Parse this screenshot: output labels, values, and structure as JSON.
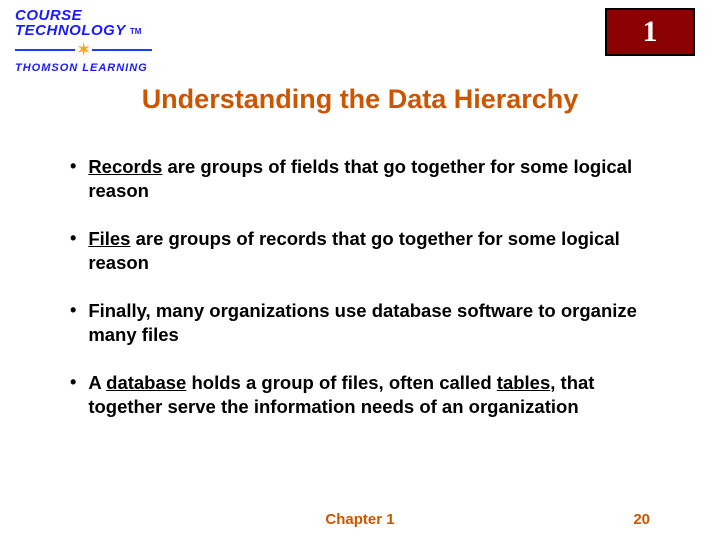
{
  "logo": {
    "line1": "COURSE",
    "line2": "TECHNOLOGY",
    "tm": "TM",
    "line3": "THOMSON LEARNING"
  },
  "chapterBadge": "1",
  "title": "Understanding the Data Hierarchy",
  "bullets": [
    {
      "pre": "",
      "term": "Records",
      "post": " are groups of fields that go together for some logical reason"
    },
    {
      "pre": "",
      "term": "Files",
      "post": " are groups of records that go together for some logical reason"
    },
    {
      "pre": "Finally, many organizations use database software to organize many files",
      "term": "",
      "post": ""
    },
    {
      "pre": "A ",
      "term": "database",
      "post": " holds a group of files, often called ",
      "term2": "tables",
      "post2": ", that together serve the information needs of an organization"
    }
  ],
  "footer": {
    "chapter": "Chapter 1",
    "page": "20"
  }
}
